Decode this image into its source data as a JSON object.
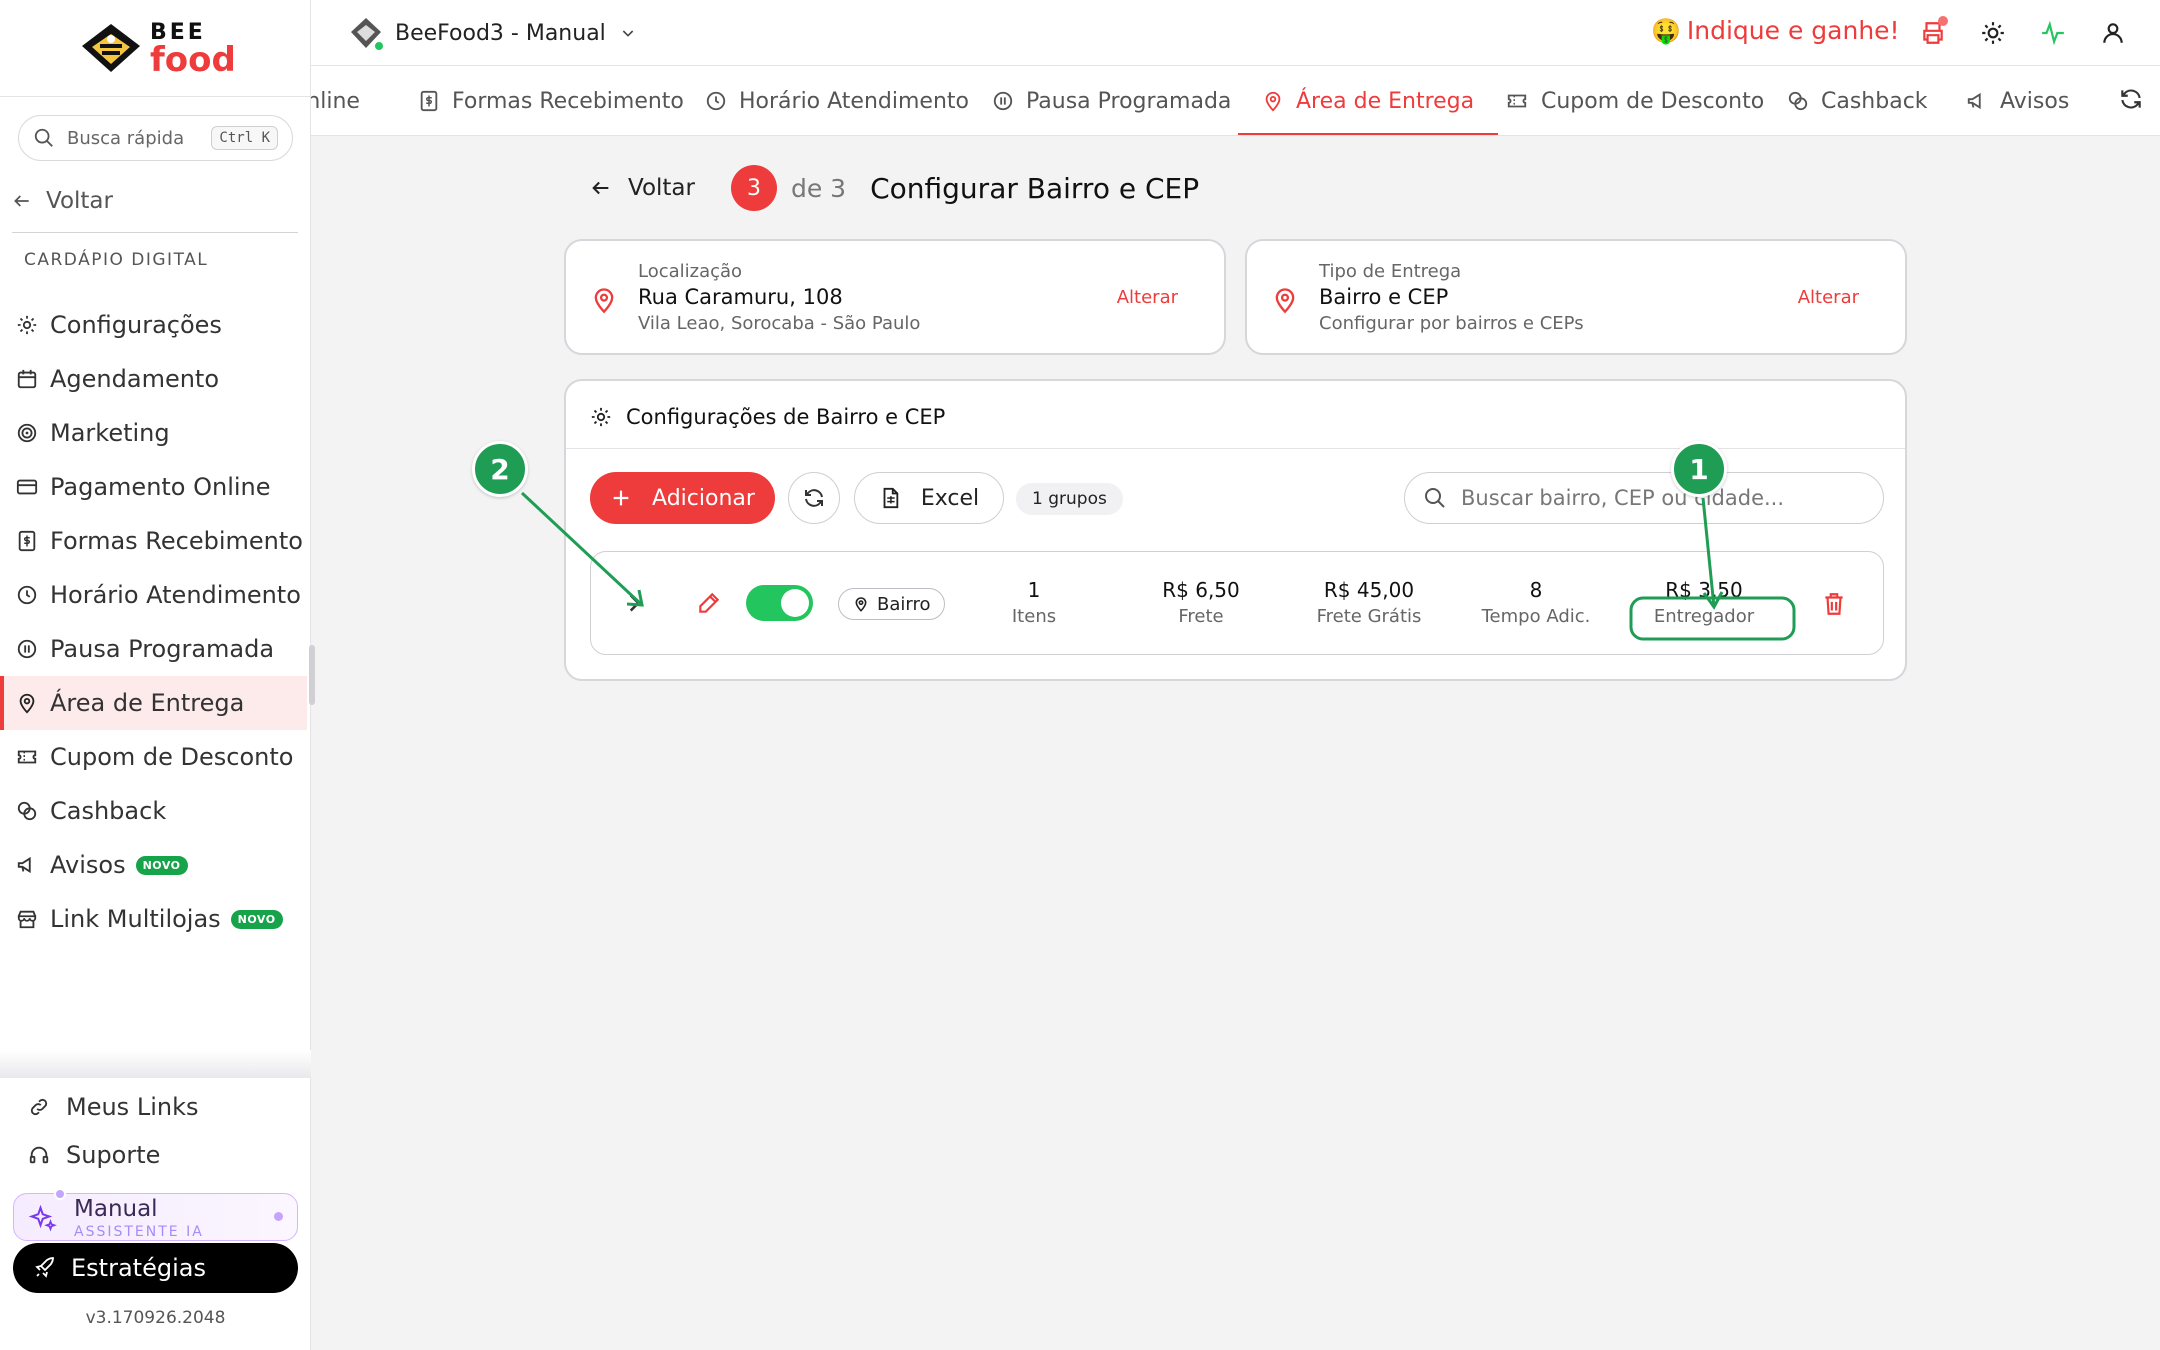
{
  "brand": {
    "line1": "BEE",
    "line2": "food"
  },
  "sidebar": {
    "search_placeholder": "Busca rápida",
    "search_shortcut": "Ctrl K",
    "back_label": "Voltar",
    "section_title": "CARDÁPIO DIGITAL",
    "items": [
      {
        "label": "Configurações",
        "icon": "gear-icon"
      },
      {
        "label": "Agendamento",
        "icon": "calendar-icon"
      },
      {
        "label": "Marketing",
        "icon": "target-icon"
      },
      {
        "label": "Pagamento Online",
        "icon": "credit-card-icon"
      },
      {
        "label": "Formas Recebimento",
        "icon": "receipt-icon"
      },
      {
        "label": "Horário Atendimento",
        "icon": "clock-icon"
      },
      {
        "label": "Pausa Programada",
        "icon": "pause-icon"
      },
      {
        "label": "Área de Entrega",
        "icon": "map-pin-icon",
        "active": true
      },
      {
        "label": "Cupom de Desconto",
        "icon": "ticket-icon"
      },
      {
        "label": "Cashback",
        "icon": "coins-icon"
      },
      {
        "label": "Avisos",
        "icon": "megaphone-icon",
        "badge": "NOVO"
      },
      {
        "label": "Link Multilojas",
        "icon": "store-icon",
        "badge": "NOVO"
      }
    ],
    "bottom_links": [
      {
        "label": "Meus Links",
        "icon": "link-icon"
      },
      {
        "label": "Suporte",
        "icon": "headset-icon"
      }
    ],
    "assistant": {
      "title": "Manual",
      "subtitle": "ASSISTENTE IA"
    },
    "strategies_label": "Estratégias",
    "version": "v3.170926.2048"
  },
  "topbar": {
    "store_name": "BeeFood3 - Manual",
    "referral": {
      "emoji": "🤑",
      "label": "Indique e ganhe!"
    },
    "icons": [
      "printer-icon",
      "sun-icon",
      "activity-icon",
      "user-icon"
    ]
  },
  "tabs": [
    {
      "label": "Online",
      "icon": "",
      "active": false
    },
    {
      "label": "Formas Recebimento",
      "icon": "receipt-icon",
      "active": false
    },
    {
      "label": "Horário Atendimento",
      "icon": "clock-icon",
      "active": false
    },
    {
      "label": "Pausa Programada",
      "icon": "pause-icon",
      "active": false
    },
    {
      "label": "Área de Entrega",
      "icon": "map-pin-icon",
      "active": true
    },
    {
      "label": "Cupom de Desconto",
      "icon": "ticket-icon",
      "active": false
    },
    {
      "label": "Cashback",
      "icon": "coins-icon",
      "active": false
    },
    {
      "label": "Avisos",
      "icon": "megaphone-icon",
      "active": false
    }
  ],
  "page": {
    "back_label": "Voltar",
    "step_current": "3",
    "step_of": "de 3",
    "title": "Configurar Bairro e CEP"
  },
  "location_card": {
    "label": "Localização",
    "value": "Rua Caramuru, 108",
    "sub": "Vila Leao, Sorocaba - São Paulo",
    "action": "Alterar"
  },
  "delivery_type_card": {
    "label": "Tipo de Entrega",
    "value": "Bairro e CEP",
    "sub": "Configurar por bairros e CEPs",
    "action": "Alterar"
  },
  "config": {
    "title": "Configurações de Bairro e CEP",
    "add_label": "Adicionar",
    "excel_label": "Excel",
    "groups_badge": "1 grupos",
    "search_placeholder": "Buscar bairro, CEP ou cidade...",
    "row": {
      "enabled": true,
      "type_label": "Bairro",
      "stats": [
        {
          "value": "1",
          "label": "Itens"
        },
        {
          "value": "R$ 6,50",
          "label": "Frete"
        },
        {
          "value": "R$ 45,00",
          "label": "Frete Grátis"
        },
        {
          "value": "8",
          "label": "Tempo Adic."
        },
        {
          "value": "R$ 3,50",
          "label": "Entregador"
        }
      ]
    }
  },
  "annotations": [
    {
      "number": "1",
      "color": "#1f9d55"
    },
    {
      "number": "2",
      "color": "#1f9d55"
    }
  ],
  "colors": {
    "accent": "#ee3b3b",
    "success": "#22c55e",
    "annotation": "#1f9d55"
  }
}
